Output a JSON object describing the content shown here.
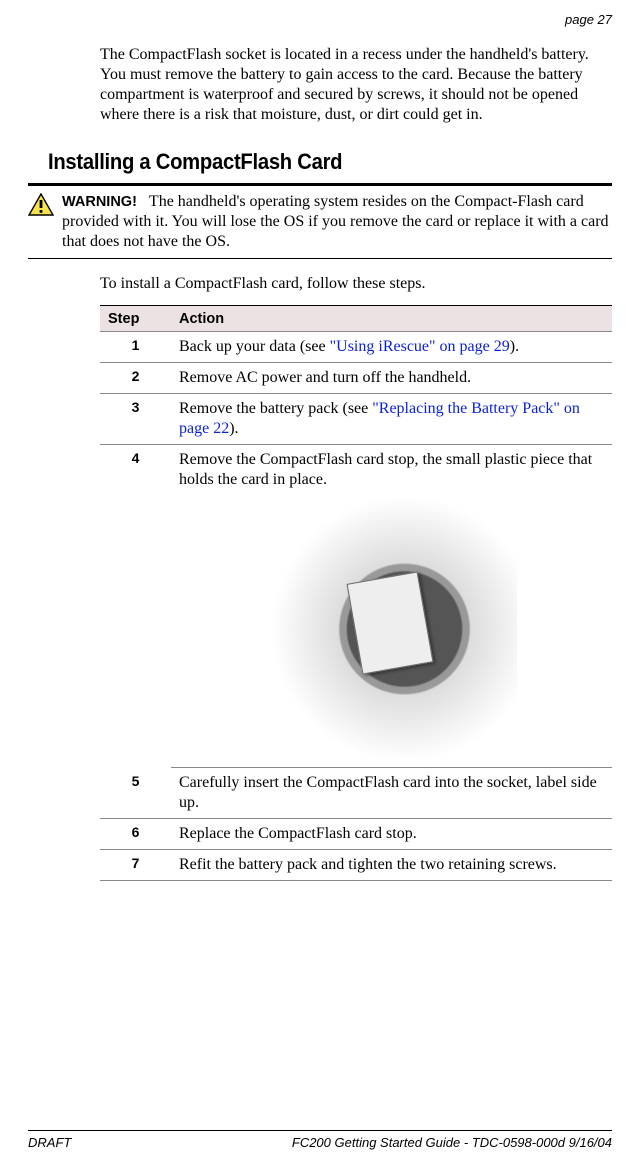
{
  "page_number": "page 27",
  "intro": "The CompactFlash socket is located in a recess under the handheld's battery. You must remove the battery to gain access to the card. Because the battery compartment is waterproof and secured by screws, it should not be opened where there is a risk that moisture, dust, or dirt could get in.",
  "section_heading": "Installing a CompactFlash Card",
  "warning": {
    "label": "WARNING!",
    "text": "The handheld's operating system resides on the Compact-Flash card provided with it. You will lose the OS if you remove the card or replace it with a card that does not have the OS."
  },
  "lead_in": "To install a CompactFlash card, follow these steps.",
  "table": {
    "headers": {
      "step": "Step",
      "action": "Action"
    },
    "rows": [
      {
        "num": "1",
        "pre": "Back up your data (see ",
        "link": "\"Using iRescue\" on page 29",
        "post": ")."
      },
      {
        "num": "2",
        "pre": "Remove AC power and turn off the handheld.",
        "link": "",
        "post": ""
      },
      {
        "num": "3",
        "pre": "Remove the battery pack (see ",
        "link": "\"Replacing the Battery Pack\" on page 22",
        "post": ")."
      },
      {
        "num": "4",
        "pre": "Remove the CompactFlash card stop, the small plastic piece that holds the card in place.",
        "link": "",
        "post": ""
      },
      {
        "num": "5",
        "pre": "Carefully insert the CompactFlash card into the socket, label side up.",
        "link": "",
        "post": ""
      },
      {
        "num": "6",
        "pre": "Replace the CompactFlash card stop.",
        "link": "",
        "post": ""
      },
      {
        "num": "7",
        "pre": "Refit the battery pack and tighten the two retaining screws.",
        "link": "",
        "post": ""
      }
    ]
  },
  "footer": {
    "left": "DRAFT",
    "right": "FC200 Getting Started Guide - TDC-0598-000d   9/16/04"
  }
}
